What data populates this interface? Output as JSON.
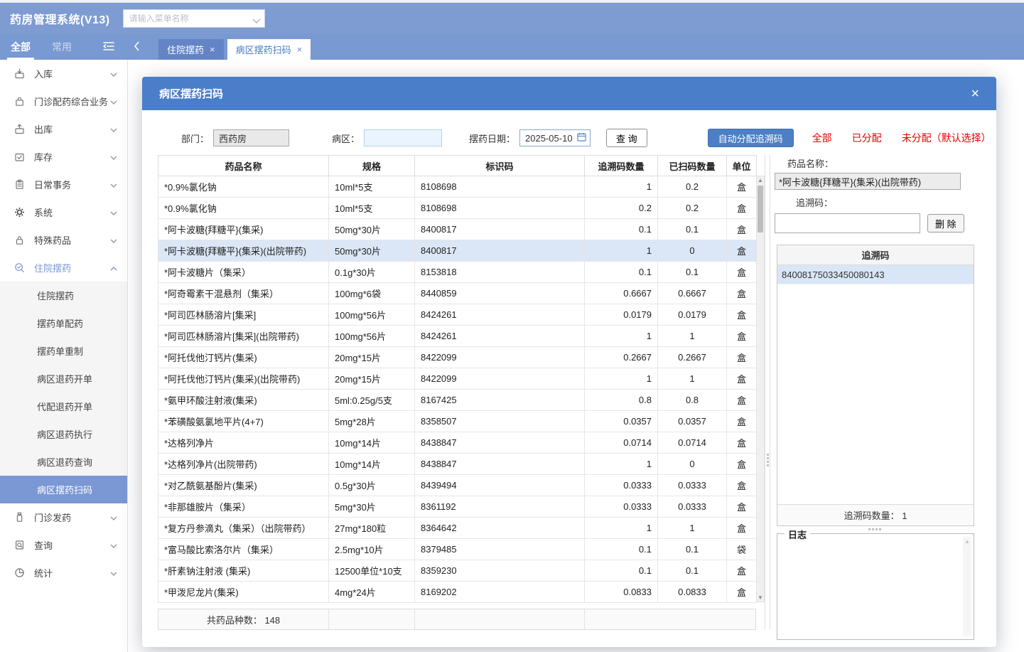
{
  "app": {
    "title": "药房管理系统(V13)",
    "search_placeholder": "请输入菜单名称"
  },
  "tabbar": {
    "filters": [
      {
        "label": "全部",
        "active": true
      },
      {
        "label": "常用",
        "active": false
      }
    ],
    "tabs": [
      {
        "label": "住院摆药",
        "active": false,
        "close": "×"
      },
      {
        "label": "病区摆药扫码",
        "active": true,
        "close": "×"
      }
    ]
  },
  "sidebar": {
    "items": [
      {
        "label": "入库",
        "icon": "inbound-icon"
      },
      {
        "label": "门诊配药综合业务",
        "icon": "clinic-dispense-icon"
      },
      {
        "label": "出库",
        "icon": "outbound-icon"
      },
      {
        "label": "库存",
        "icon": "inventory-icon"
      },
      {
        "label": "日常事务",
        "icon": "daily-tasks-icon"
      },
      {
        "label": "系统",
        "icon": "system-gear-icon"
      },
      {
        "label": "特殊药品",
        "icon": "special-drugs-icon"
      },
      {
        "label": "住院摆药",
        "icon": "inpatient-dispense-icon",
        "expanded": true,
        "children": [
          {
            "label": "住院摆药"
          },
          {
            "label": "摆药单配药"
          },
          {
            "label": "摆药单重制"
          },
          {
            "label": "病区退药开单"
          },
          {
            "label": "代配退药开单"
          },
          {
            "label": "病区退药执行"
          },
          {
            "label": "病区退药查询"
          },
          {
            "label": "病区摆药扫码",
            "selected": true
          }
        ]
      },
      {
        "label": "门诊发药",
        "icon": "outpatient-dispense-icon"
      },
      {
        "label": "查询",
        "icon": "query-icon"
      },
      {
        "label": "统计",
        "icon": "stats-icon"
      }
    ]
  },
  "modal": {
    "title": "病区摆药扫码",
    "close": "×",
    "filters": {
      "dept_label": "部门：",
      "dept_value": "西药房",
      "ward_label": "病区：",
      "ward_value": "",
      "date_label": "摆药日期：",
      "date_value": "2025-05-10",
      "query_button": "查 询",
      "auto_assign_button": "自动分配追溯码",
      "links": [
        "全部",
        "已分配",
        "未分配（默认选择）"
      ]
    },
    "table": {
      "columns": [
        {
          "label": "药品名称",
          "align": "left"
        },
        {
          "label": "规格",
          "align": "left"
        },
        {
          "label": "标识码",
          "align": "left"
        },
        {
          "label": "追溯码数量",
          "align": "right"
        },
        {
          "label": "已扫码数量",
          "align": "center"
        },
        {
          "label": "单位",
          "align": "center"
        }
      ],
      "selected_row_index": 3,
      "rows": [
        [
          "*0.9%氯化钠",
          "10ml*5支",
          "8108698",
          "1",
          "0.2",
          "盒"
        ],
        [
          "*0.9%氯化钠",
          "10ml*5支",
          "8108698",
          "0.2",
          "0.2",
          "盒"
        ],
        [
          "*阿卡波糖{拜糖平}(集采)",
          "50mg*30片",
          "8400817",
          "0.1",
          "0.1",
          "盒"
        ],
        [
          "*阿卡波糖{拜糖平}(集采)(出院带药)",
          "50mg*30片",
          "8400817",
          "1",
          "0",
          "盒"
        ],
        [
          "*阿卡波糖片（集采）",
          "0.1g*30片",
          "8153818",
          "0.1",
          "0.1",
          "盒"
        ],
        [
          "*阿奇霉素干混悬剂（集采）",
          "100mg*6袋",
          "8440859",
          "0.6667",
          "0.6667",
          "盒"
        ],
        [
          "*阿司匹林肠溶片[集采]",
          "100mg*56片",
          "8424261",
          "0.0179",
          "0.0179",
          "盒"
        ],
        [
          "*阿司匹林肠溶片[集采](出院带药)",
          "100mg*56片",
          "8424261",
          "1",
          "1",
          "盒"
        ],
        [
          "*阿托伐他汀钙片(集采)",
          "20mg*15片",
          "8422099",
          "0.2667",
          "0.2667",
          "盒"
        ],
        [
          "*阿托伐他汀钙片(集采)(出院带药)",
          "20mg*15片",
          "8422099",
          "1",
          "1",
          "盒"
        ],
        [
          "*氨甲环酸注射液(集采)",
          "5ml:0.25g/5支",
          "8167425",
          "0.8",
          "0.8",
          "盒"
        ],
        [
          "*苯磺酸氨氯地平片(4+7)",
          "5mg*28片",
          "8358507",
          "0.0357",
          "0.0357",
          "盒"
        ],
        [
          "*达格列净片",
          "10mg*14片",
          "8438847",
          "0.0714",
          "0.0714",
          "盒"
        ],
        [
          "*达格列净片(出院带药)",
          "10mg*14片",
          "8438847",
          "1",
          "0",
          "盒"
        ],
        [
          "*对乙酰氨基酚片(集采)",
          "0.5g*30片",
          "8439494",
          "0.0333",
          "0.0333",
          "盒"
        ],
        [
          "*非那雄胺片（集采）",
          "5mg*30片",
          "8361192",
          "0.0333",
          "0.0333",
          "盒"
        ],
        [
          "*复方丹参滴丸（集采）（出院带药）",
          "27mg*180粒",
          "8364642",
          "1",
          "1",
          "盒"
        ],
        [
          "*富马酸比索洛尔片（集采）",
          "2.5mg*10片",
          "8379485",
          "0.1",
          "0.1",
          "袋"
        ],
        [
          "*肝素钠注射液 (集采)",
          "12500单位*10支",
          "8359230",
          "0.1",
          "0.1",
          "盒"
        ],
        [
          "*甲泼尼龙片(集采)",
          "4mg*24片",
          "8169202",
          "0.0833",
          "0.0833",
          "盒"
        ]
      ],
      "footer": "共药品种数： 148"
    },
    "detail": {
      "drug_name_label": "药品名称：",
      "drug_name_value": "*阿卡波糖{拜糖平}(集采)(出院带药)",
      "trace_label": "追溯码：",
      "trace_input_value": "",
      "delete_button": "删 除",
      "trace_list_header": "追溯码",
      "trace_codes": [
        "84008175033450080143"
      ],
      "trace_count": "追溯码数量： 1",
      "log_label": "日志"
    }
  },
  "colors": {
    "topbar": "#7e9bd2",
    "tabbar": "#7899d1",
    "inactive_tab": "#6384c6",
    "modal_header": "#4a7ec8",
    "accent_button": "#4d7fc4",
    "red_link": "#e60000",
    "selected_row": "#dbe7f6",
    "sidebar_selected": "#7b97d4"
  }
}
